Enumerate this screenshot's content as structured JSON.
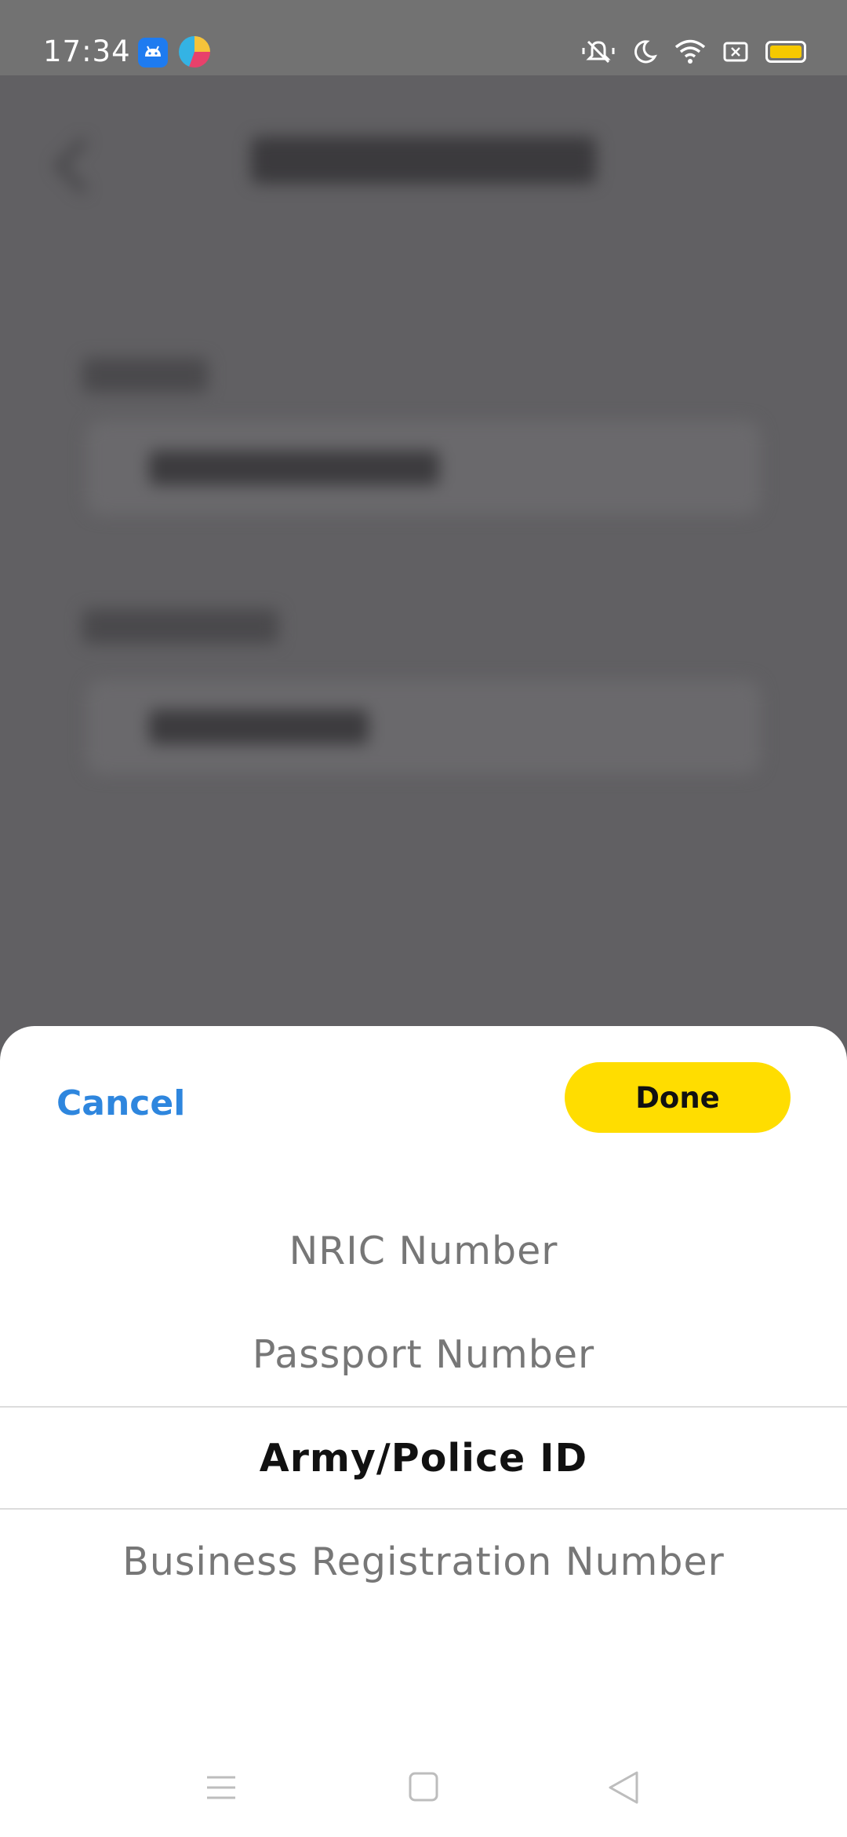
{
  "status_bar": {
    "time": "17:34",
    "left_icons": [
      "android-app-icon",
      "browser-app-icon"
    ],
    "right_icons": [
      "vibrate-icon",
      "do-not-disturb-icon",
      "wifi-icon",
      "no-sim-icon",
      "battery-icon"
    ],
    "battery_color": "#f6c900"
  },
  "sheet": {
    "cancel_label": "Cancel",
    "done_label": "Done",
    "accent_color": "#2e86de",
    "done_color": "#ffdd00",
    "options": [
      {
        "label": "NRIC Number",
        "selected": false
      },
      {
        "label": "Passport Number",
        "selected": false
      },
      {
        "label": "Army/Police ID",
        "selected": true
      },
      {
        "label": "Business Registration Number",
        "selected": false
      }
    ]
  },
  "nav_bar": {
    "buttons": [
      "menu-icon",
      "home-icon",
      "back-icon"
    ]
  }
}
